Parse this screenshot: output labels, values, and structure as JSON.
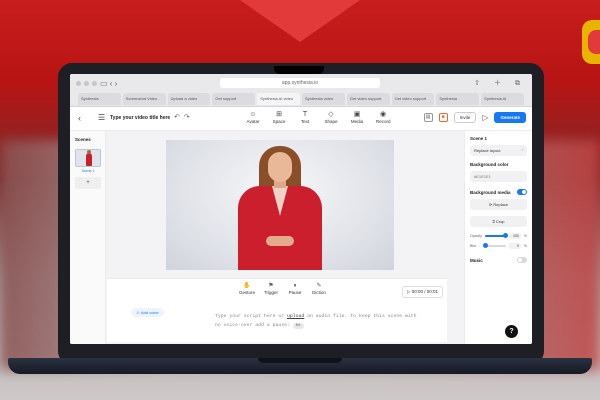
{
  "browser": {
    "url": "app.synthesia.io",
    "tabs": [
      "Synthesia",
      "Screenshot Video",
      "Upload a video",
      "Get support",
      "Synthesia AI video",
      "Synthesia video",
      "Get video support",
      "Get video support",
      "Synthesia",
      "Synthesia AI"
    ]
  },
  "toolbar": {
    "title": "Type your video title here",
    "tools": [
      {
        "label": "Avatar",
        "icon": "avatar-icon",
        "glyph": "☺"
      },
      {
        "label": "Space",
        "icon": "space-icon",
        "glyph": "⊞"
      },
      {
        "label": "Text",
        "icon": "text-icon",
        "glyph": "T"
      },
      {
        "label": "Shape",
        "icon": "shape-icon",
        "glyph": "◇"
      },
      {
        "label": "Media",
        "icon": "media-icon",
        "glyph": "▣"
      },
      {
        "label": "Record",
        "icon": "record-icon",
        "glyph": "◉"
      }
    ],
    "invite_label": "Invite",
    "generate_label": "Generate"
  },
  "scenes": {
    "title": "Scenes",
    "items": [
      {
        "label": "Scene 1"
      }
    ],
    "add_label": "+"
  },
  "script": {
    "tools": [
      {
        "label": "Gesture",
        "icon": "gesture-icon",
        "glyph": "✋"
      },
      {
        "label": "Trigger",
        "icon": "trigger-icon",
        "glyph": "⚑"
      },
      {
        "label": "Pause",
        "icon": "pause-icon",
        "glyph": "⏸"
      },
      {
        "label": "Diction",
        "icon": "diction-icon",
        "glyph": "✎"
      }
    ],
    "timer": "00:00 / 00:01",
    "add_voice": "Add voice",
    "placeholder_before": "Type your script here or ",
    "placeholder_link": "upload",
    "placeholder_after": " an audio file. To keep this scene with no voice-over add a pause: ",
    "pause_chip": "0s"
  },
  "right_panel": {
    "scene_title": "Scene 1",
    "layout_label": "Replace layout",
    "bg_color_title": "Background color",
    "bg_color_value": "#E1E1E1",
    "bg_media_title": "Background media",
    "bg_media_on": true,
    "replace_label": "Replace",
    "crop_label": "Crop",
    "opacity_label": "Opacity",
    "opacity_value": 100,
    "blur_label": "Blur",
    "blur_value": 0,
    "unit": "%",
    "music_title": "Music",
    "music_on": false
  },
  "help_label": "?"
}
